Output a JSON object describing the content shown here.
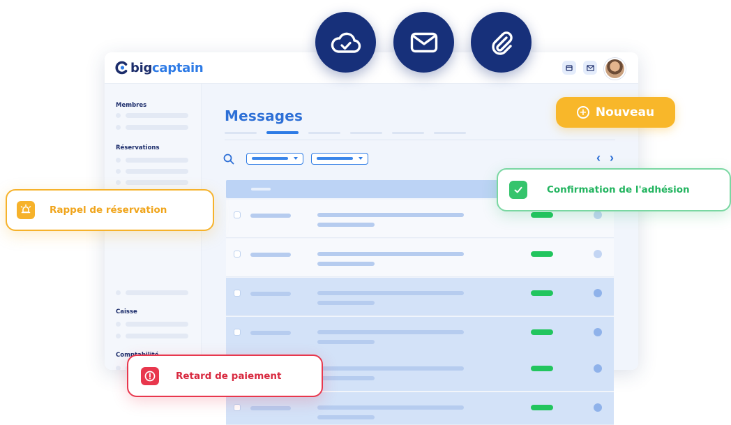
{
  "app": {
    "logo_part1": "big",
    "logo_part2": "captain"
  },
  "topbar": {
    "icons": [
      "calendar-icon",
      "mail-icon"
    ],
    "avatar": "user-avatar"
  },
  "floating_actions": [
    {
      "icon": "cloud-check-icon"
    },
    {
      "icon": "mail-icon"
    },
    {
      "icon": "paperclip-icon"
    }
  ],
  "sidebar": {
    "sections": [
      "Membres",
      "Réservations",
      "Caisse",
      "Comptabilité"
    ]
  },
  "main": {
    "title": "Messages",
    "tabs_count": 6,
    "active_tab_index": 1
  },
  "new_button": {
    "label": "Nouveau",
    "icon": "plus-circle-icon"
  },
  "notifications": {
    "reminder": {
      "label": "Rappel de réservation",
      "icon": "alarm-bell-icon",
      "color": "#f6b22b"
    },
    "confirm": {
      "label": "Confirmation de l'adhésion",
      "icon": "check-icon",
      "color": "#35c46c"
    },
    "late": {
      "label": "Retard de paiement",
      "icon": "alert-icon",
      "color": "#e8374d"
    }
  },
  "colors": {
    "brand_dark": "#1c2d6b",
    "brand_blue": "#2e7be6",
    "accent_yellow": "#f8b72a",
    "status_green": "#22c55e"
  }
}
